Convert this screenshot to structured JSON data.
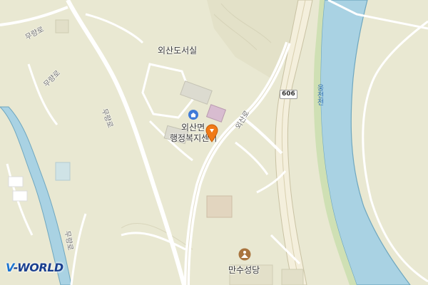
{
  "map": {
    "places": {
      "library": "외산도서실",
      "welfare_center_line1": "외산면",
      "welfare_center_line2": "행정복지센터",
      "church": "만수성당"
    },
    "roads": {
      "musan_ro_1": "무량로",
      "musan_ro_2": "무량로",
      "musan_ro_3": "무량로",
      "musan_ro_4": "무량로",
      "oesan_ro": "외산로",
      "route_number": "606"
    },
    "river": "웅천천",
    "colors": {
      "land": "#e9e8d2",
      "river": "#a9d2e3",
      "river_edge": "#6fa7bf",
      "road": "#ffffff",
      "marker": "#f07a17"
    },
    "icons": [
      "house-icon",
      "location-marker-icon",
      "church-icon"
    ]
  },
  "logo": {
    "prefix": "V",
    "suffix": "-WORLD"
  }
}
